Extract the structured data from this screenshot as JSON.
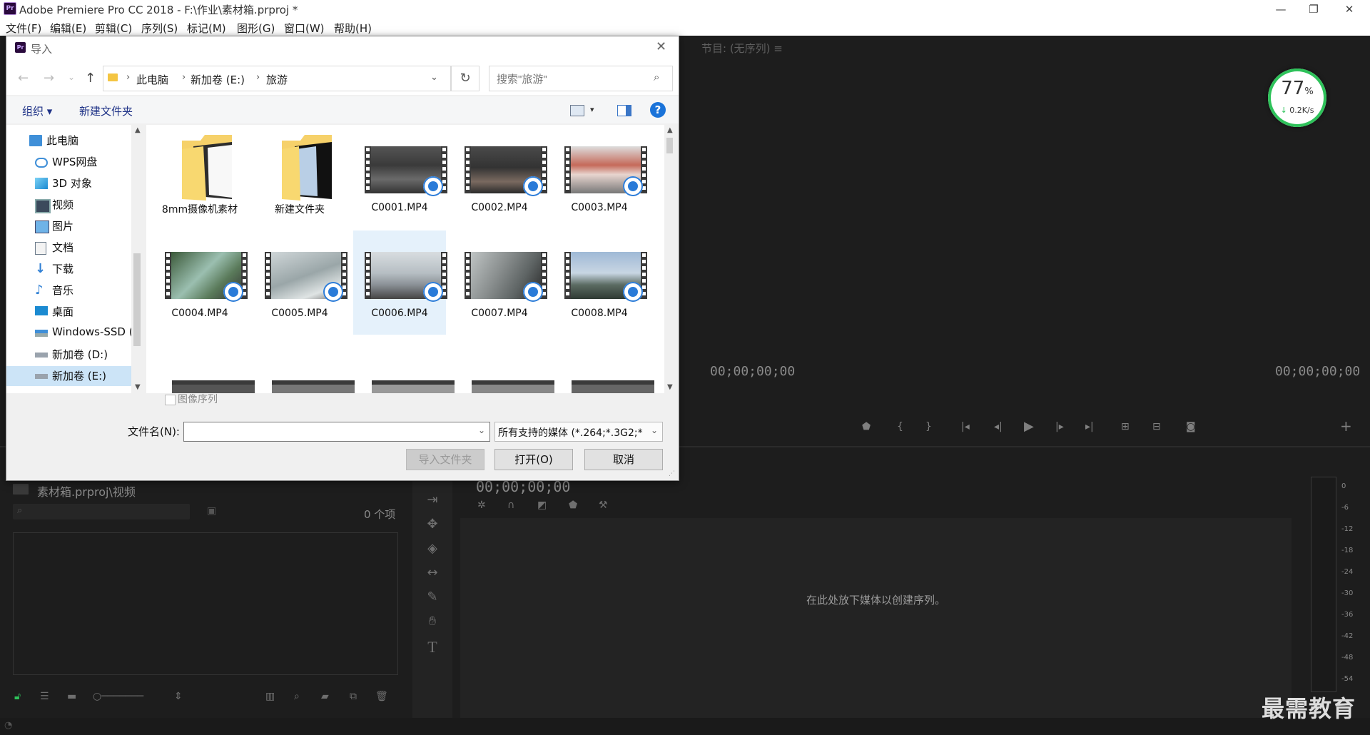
{
  "app": {
    "title": "Adobe Premiere Pro CC 2018 - F:\\作业\\素材箱.prproj *",
    "logo": "Pr",
    "window_controls": [
      "—",
      "❐",
      "✕"
    ]
  },
  "menu": [
    "文件(F)",
    "编辑(E)",
    "剪辑(C)",
    "序列(S)",
    "标记(M)",
    "图形(G)",
    "窗口(W)",
    "帮助(H)"
  ],
  "program_monitor": {
    "label": "节目: (无序列) ≡",
    "timecode_left": "00;00;00;00",
    "timecode_right": "00;00;00;00"
  },
  "speed_widget": {
    "percent": "77",
    "unit": "%",
    "rate": "0.2K/s",
    "color": "#2ec25a"
  },
  "project_panel": {
    "crumb": "素材箱.prproj\\视频",
    "count": "0 个项"
  },
  "timeline": {
    "timecode": "00;00;00;00",
    "hint": "在此处放下媒体以创建序列。"
  },
  "audio_meter": {
    "db_labels": [
      "0",
      "-6",
      "-12",
      "-18",
      "-24",
      "-30",
      "-36",
      "-42",
      "-48",
      "-54"
    ]
  },
  "watermark": "最需教育",
  "dialog": {
    "logo": "Pr",
    "title": "导入",
    "address": [
      "此电脑",
      "新加卷 (E:)",
      "旅游"
    ],
    "search_placeholder": "搜索\"旅游\"",
    "organize": "组织 ▾",
    "new_folder": "新建文件夹",
    "help": "?",
    "nav_items": [
      {
        "label": "此电脑",
        "icon": "computer-icon"
      },
      {
        "label": "WPS网盘",
        "icon": "cloud-icon"
      },
      {
        "label": "3D 对象",
        "icon": "cube-icon"
      },
      {
        "label": "视频",
        "icon": "video-icon"
      },
      {
        "label": "图片",
        "icon": "picture-icon"
      },
      {
        "label": "文档",
        "icon": "document-icon"
      },
      {
        "label": "下载",
        "icon": "download-icon"
      },
      {
        "label": "音乐",
        "icon": "music-icon"
      },
      {
        "label": "桌面",
        "icon": "desktop-icon"
      },
      {
        "label": "Windows-SSD (C",
        "icon": "drive-icon"
      },
      {
        "label": "新加卷 (D:)",
        "icon": "drive-icon"
      },
      {
        "label": "新加卷 (E:)",
        "icon": "drive-icon"
      }
    ],
    "files": [
      {
        "name": "8mm摄像机素材",
        "type": "folder"
      },
      {
        "name": "新建文件夹",
        "type": "folder"
      },
      {
        "name": "C0001.MP4",
        "type": "video"
      },
      {
        "name": "C0002.MP4",
        "type": "video"
      },
      {
        "name": "C0003.MP4",
        "type": "video"
      },
      {
        "name": "C0004.MP4",
        "type": "video"
      },
      {
        "name": "C0005.MP4",
        "type": "video"
      },
      {
        "name": "C0006.MP4",
        "type": "video",
        "selected": true
      },
      {
        "name": "C0007.MP4",
        "type": "video"
      },
      {
        "name": "C0008.MP4",
        "type": "video"
      }
    ],
    "image_sequence": "图像序列",
    "filename_label": "文件名(N):",
    "filename_value": "",
    "filetype": "所有支持的媒体 (*.264;*.3G2;*",
    "btn_import_folder": "导入文件夹",
    "btn_open": "打开(O)",
    "btn_cancel": "取消"
  }
}
